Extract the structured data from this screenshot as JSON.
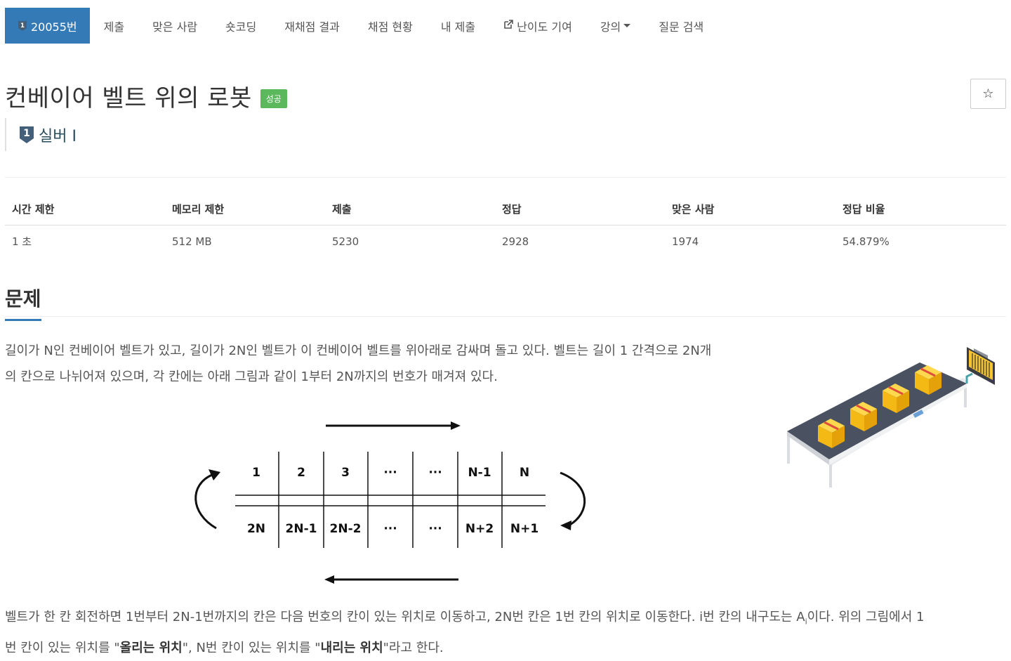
{
  "nav": {
    "tabs": [
      {
        "label": "20055번",
        "active": true
      },
      {
        "label": "제출"
      },
      {
        "label": "맞은 사람"
      },
      {
        "label": "숏코딩"
      },
      {
        "label": "재채점 결과"
      },
      {
        "label": "채점 현황"
      },
      {
        "label": "내 제출"
      },
      {
        "label": "난이도 기여",
        "icon": "external-link-icon"
      },
      {
        "label": "강의",
        "dropdown": true
      },
      {
        "label": "질문 검색"
      }
    ]
  },
  "problem": {
    "title": "컨베이어 벨트 위의 로봇",
    "status_badge": "성공",
    "tier_label": "실버 I",
    "tier_number": "1",
    "star_icon": "star-outline-icon"
  },
  "stats": {
    "headers": [
      "시간 제한",
      "메모리 제한",
      "제출",
      "정답",
      "맞은 사람",
      "정답 비율"
    ],
    "values": [
      "1 초",
      "512 MB",
      "5230",
      "2928",
      "1974",
      "54.879%"
    ]
  },
  "section": {
    "title": "문제",
    "para1_line1": "길이가 N인 컨베이어 벨트가 있고, 길이가 2N인 벨트가 이 컨베이어 벨트를 위아래로 감싸며 돌고 있다. 벨트는 길이 1 간격으로 2N개",
    "para1_line2": "의 칸으로 나뉘어져 있으며, 각 칸에는 아래 그림과 같이 1부터 2N까지의 번호가 매겨져 있다.",
    "para2_line1_a": "벨트가 한 칸 회전하면 1번부터 2N-1번까지의 칸은 다음 번호의 칸이 있는 위치로 이동하고, 2N번 칸은 1번 칸의 위치로 이동한다. i번 칸의 내구도는 A",
    "para2_line1_sub": "i",
    "para2_line1_b": "이다. 위의 그림에서 1",
    "para2_line2_a": "번 칸이 있는 위치를 \"",
    "para2_line2_bold1": "올리는 위치",
    "para2_line2_b": "\", N번 칸이 있는 위치를 \"",
    "para2_line2_bold2": "내리는 위치",
    "para2_line2_c": "\"라고 한다."
  },
  "diagram": {
    "top_row": [
      "1",
      "2",
      "3",
      "···",
      "···",
      "N-1",
      "N"
    ],
    "bottom_row": [
      "2N",
      "2N-1",
      "2N-2",
      "···",
      "···",
      "N+2",
      "N+1"
    ]
  }
}
